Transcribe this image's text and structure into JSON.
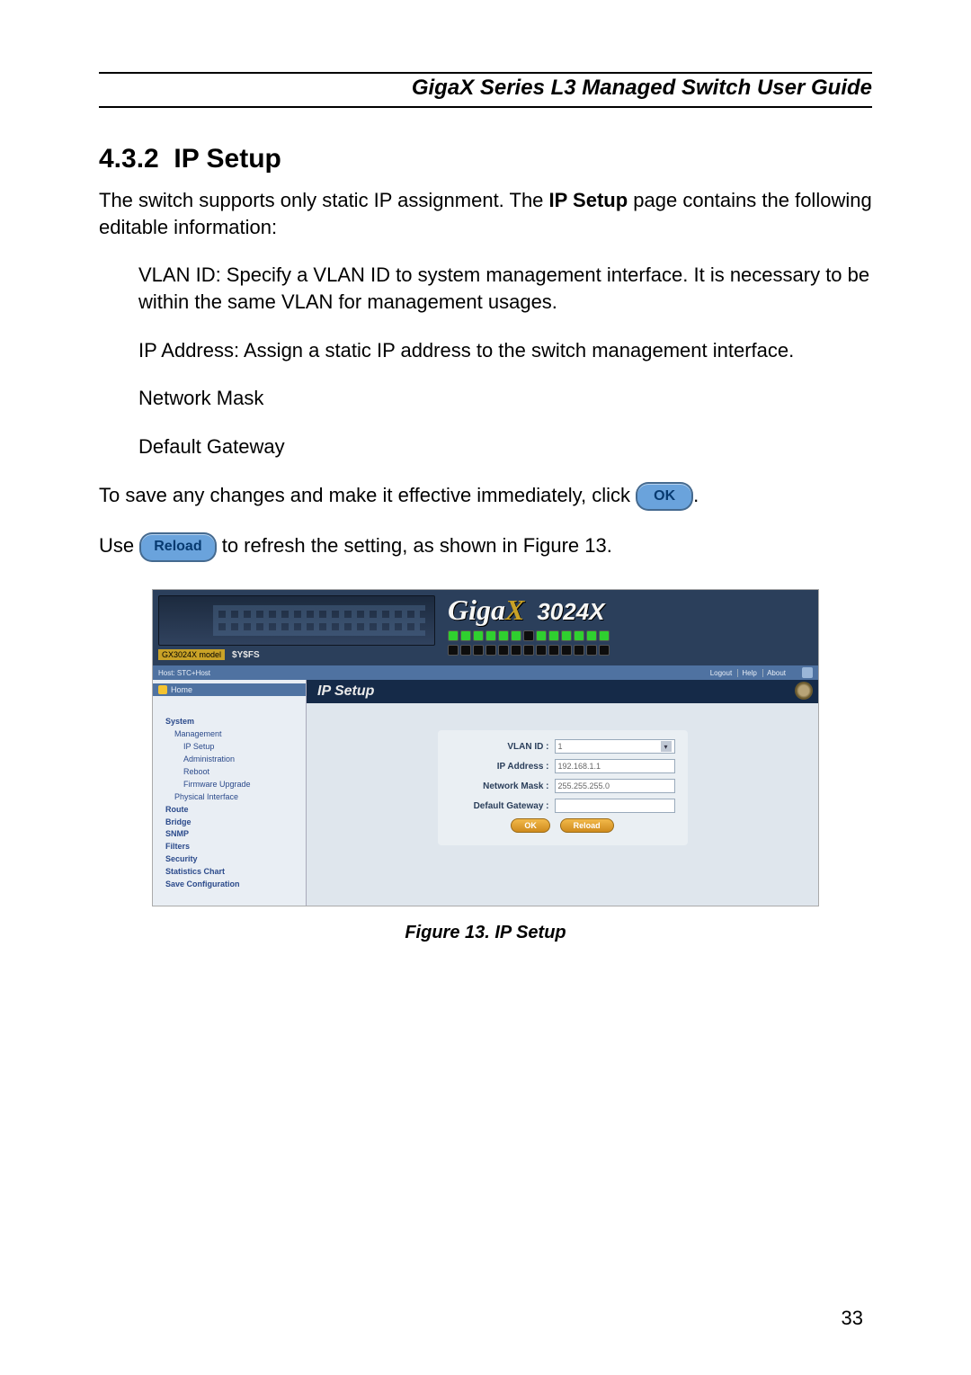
{
  "header": {
    "title": "GigaX Series L3 Managed Switch User Guide"
  },
  "section": {
    "number": "4.3.2",
    "title": "IP Setup"
  },
  "paragraphs": {
    "intro_a": "The switch supports only static IP assignment. The ",
    "intro_bold": "IP Setup",
    "intro_b": " page contains the following editable information:",
    "vlan": "VLAN ID: Specify a VLAN ID to system management interface. It is necessary to be within the same VLAN for management usages.",
    "ip": "IP Address: Assign a static IP address to the switch management interface.",
    "mask": "Network Mask",
    "gw": "Default Gateway",
    "save_a": "To save any changes and make it effective immediately, click ",
    "save_b": ".",
    "reload_a": "Use ",
    "reload_b": " to refresh the setting, as shown in Figure 13."
  },
  "buttons": {
    "ok": "OK",
    "reload": "Reload"
  },
  "screenshot": {
    "logo_brand": "Giga",
    "logo_x": "X",
    "logo_model": "3024X",
    "device_model_label": "GX3024X model",
    "os_label": "$Y$FS",
    "status_host": "Host: STC+Host",
    "status_links": {
      "logout": "Logout",
      "help": "Help",
      "about": "About"
    },
    "nav_home": "Home",
    "nav": {
      "system": "System",
      "management": "Management",
      "ip_setup": "IP Setup",
      "administration": "Administration",
      "reboot": "Reboot",
      "firmware": "Firmware Upgrade",
      "phys": "Physical Interface",
      "route": "Route",
      "bridge": "Bridge",
      "snmp": "SNMP",
      "filters": "Filters",
      "security": "Security",
      "stats": "Statistics Chart",
      "saveconf": "Save Configuration"
    },
    "panel_title": "IP Setup",
    "form": {
      "vlan_label": "VLAN ID :",
      "vlan_value": "1",
      "ip_label": "IP Address :",
      "ip_value": "192.168.1.1",
      "mask_label": "Network Mask :",
      "mask_value": "255.255.255.0",
      "gw_label": "Default Gateway :",
      "gw_value": "",
      "ok": "OK",
      "reload": "Reload"
    }
  },
  "figure_caption": "Figure 13.  IP Setup",
  "page_number": "33"
}
